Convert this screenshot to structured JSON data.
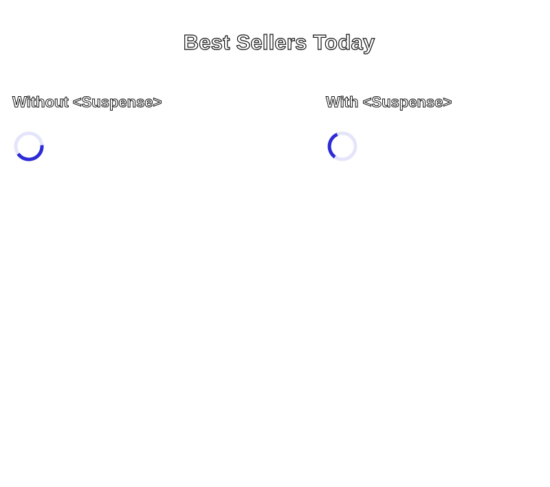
{
  "page": {
    "title": "Best Sellers Today"
  },
  "columns": [
    {
      "heading": "Without <Suspense>",
      "loading_indicator": "spinner-icon"
    },
    {
      "heading": "With <Suspense>",
      "loading_indicator": "spinner-icon"
    }
  ],
  "colors": {
    "spinner_track": "#e4e5fa",
    "spinner_arc": "#2d2bd6",
    "heading_outline": "#111111"
  }
}
